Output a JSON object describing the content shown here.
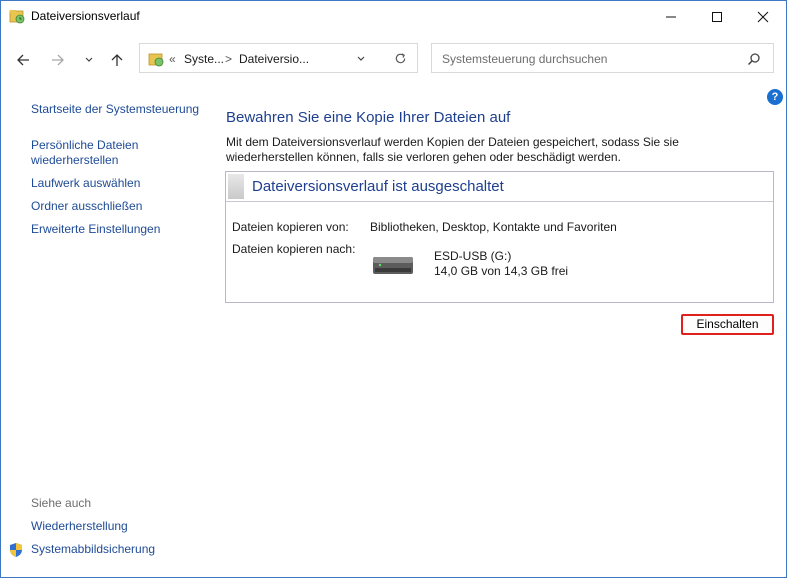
{
  "window": {
    "title": "Dateiversionsverlauf",
    "controls": {
      "minimize": "minimize-icon",
      "maximize": "maximize-icon",
      "close": "close-icon"
    }
  },
  "address": {
    "overflow": "«",
    "segments": [
      "Syste...",
      "Dateiversio..."
    ],
    "separator": ">",
    "search_placeholder": "Systemsteuerung durchsuchen"
  },
  "help": {
    "label": "?"
  },
  "sidebar": {
    "home": "Startseite der Systemsteuerung",
    "restore_line1": "Persönliche Dateien",
    "restore_line2": "wiederherstellen",
    "drive": "Laufwerk auswählen",
    "exclude": "Ordner ausschließen",
    "advanced": "Erweiterte Einstellungen",
    "see_also": "Siehe auch",
    "recovery": "Wiederherstellung",
    "system_image": "Systemabbildsicherung"
  },
  "main": {
    "title": "Bewahren Sie eine Kopie Ihrer Dateien auf",
    "description": "Mit dem Dateiversionsverlauf werden Kopien der Dateien gespeichert, sodass Sie sie wiederherstellen können, falls sie verloren gehen oder beschädigt werden.",
    "status_title": "Dateiversionsverlauf ist ausgeschaltet",
    "copy_from_label": "Dateien kopieren von:",
    "copy_from_value": "Bibliotheken, Desktop, Kontakte und Favoriten",
    "copy_to_label": "Dateien kopieren nach:",
    "drive_name": "ESD-USB (G:)",
    "drive_space": "14,0 GB von 14,3 GB frei",
    "turn_on_button": "Einschalten"
  },
  "colors": {
    "link": "#1e4b97",
    "heading": "#1e3f8f",
    "highlight_border": "#e0201c",
    "help_badge": "#1a6fd1"
  }
}
